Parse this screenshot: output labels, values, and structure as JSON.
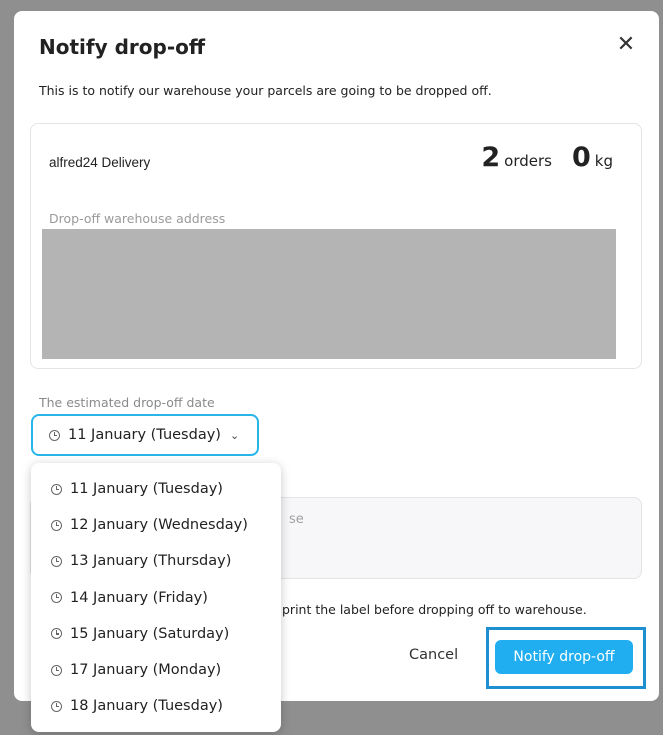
{
  "modal": {
    "title": "Notify drop-off",
    "close_icon": "close-icon",
    "subtitle": "This is to notify our warehouse your parcels are going to be dropped off."
  },
  "card": {
    "carrier": "alfred24 Delivery",
    "orders_count": "2",
    "orders_unit": "orders",
    "weight_value": "0",
    "weight_unit": "kg",
    "address_label": "Drop-off warehouse address"
  },
  "date": {
    "label": "The estimated drop-off date",
    "selected": "11 January (Tuesday)",
    "chevron_icon": "chevron-down-icon",
    "options": [
      "11 January (Tuesday)",
      "12 January (Wednesday)",
      "13 January (Thursday)",
      "14 January (Friday)",
      "15 January (Saturday)",
      "17 January (Monday)",
      "18 January (Tuesday)"
    ]
  },
  "note": {
    "placeholder_fragment": "se"
  },
  "footer": {
    "info_text": "print the label before dropping off to warehouse.",
    "cancel_label": "Cancel",
    "notify_label": "Notify drop-off"
  },
  "colors": {
    "accent": "#20aef0",
    "highlight_border": "#1e8fd0",
    "select_border": "#27b5ea"
  }
}
